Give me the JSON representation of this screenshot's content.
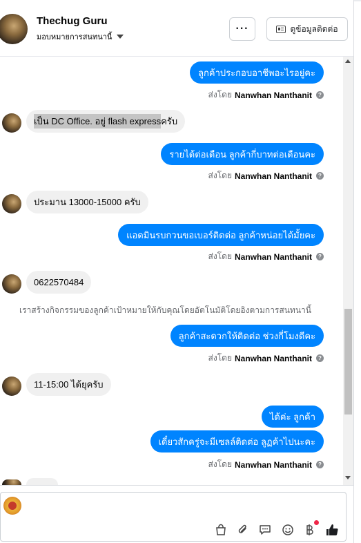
{
  "header": {
    "name": "Thechug Guru",
    "assign_label": "มอบหมายการสนทนานี้",
    "more_label": "···",
    "contact_label": "ดูข้อมูลติดต่อ"
  },
  "sender_prefix": "ส่งโดย",
  "sender_name": "Nanwhan Nanthanit",
  "messages": [
    {
      "text": "ลูกค้าประกอบอาชีพอะไรอยู่คะ"
    },
    {
      "text_highlight": "เป็น DC Office. อยู่ flash express",
      "text_rest": " ครับ"
    },
    {
      "text": "รายได้ต่อเดือน ลูกค้ากี่บาทต่อเดือนคะ"
    },
    {
      "text": "ประมาน 13000-15000 ครับ"
    },
    {
      "text": "แอดมินรบกวนขอเบอร์ติดต่อ ลูกค้าหน่อยได้มั้ยคะ"
    },
    {
      "text": "0622570484"
    },
    {
      "text": "ลูกค้าสะดวกให้ติดต่อ ช่วงกี่โมงดีคะ"
    },
    {
      "text": "11-15:00 ได้ยุครับ"
    },
    {
      "text": "ได้ค่ะ ลูกค้า"
    },
    {
      "text": "เดี๋ยวสักครู่จะมีเซลล์ติดต่อ ลูฏค้าไปนะคะ"
    }
  ],
  "system_note": "เราสร้างกิจกรรมของลูกค้าเป้าหมายให้กับคุณโดยอัตโนมัติโดยอิงตามการสนทนานี้",
  "composer": {
    "tools": [
      "shopping-bag-icon",
      "paperclip-icon",
      "saved-reply-icon",
      "emoji-icon",
      "baht-payment-icon",
      "thumbs-up-icon"
    ]
  },
  "colors": {
    "outgoing_bubble": "#0084ff",
    "incoming_bubble": "#f0f0f0",
    "notification_dot": "#f02849"
  }
}
